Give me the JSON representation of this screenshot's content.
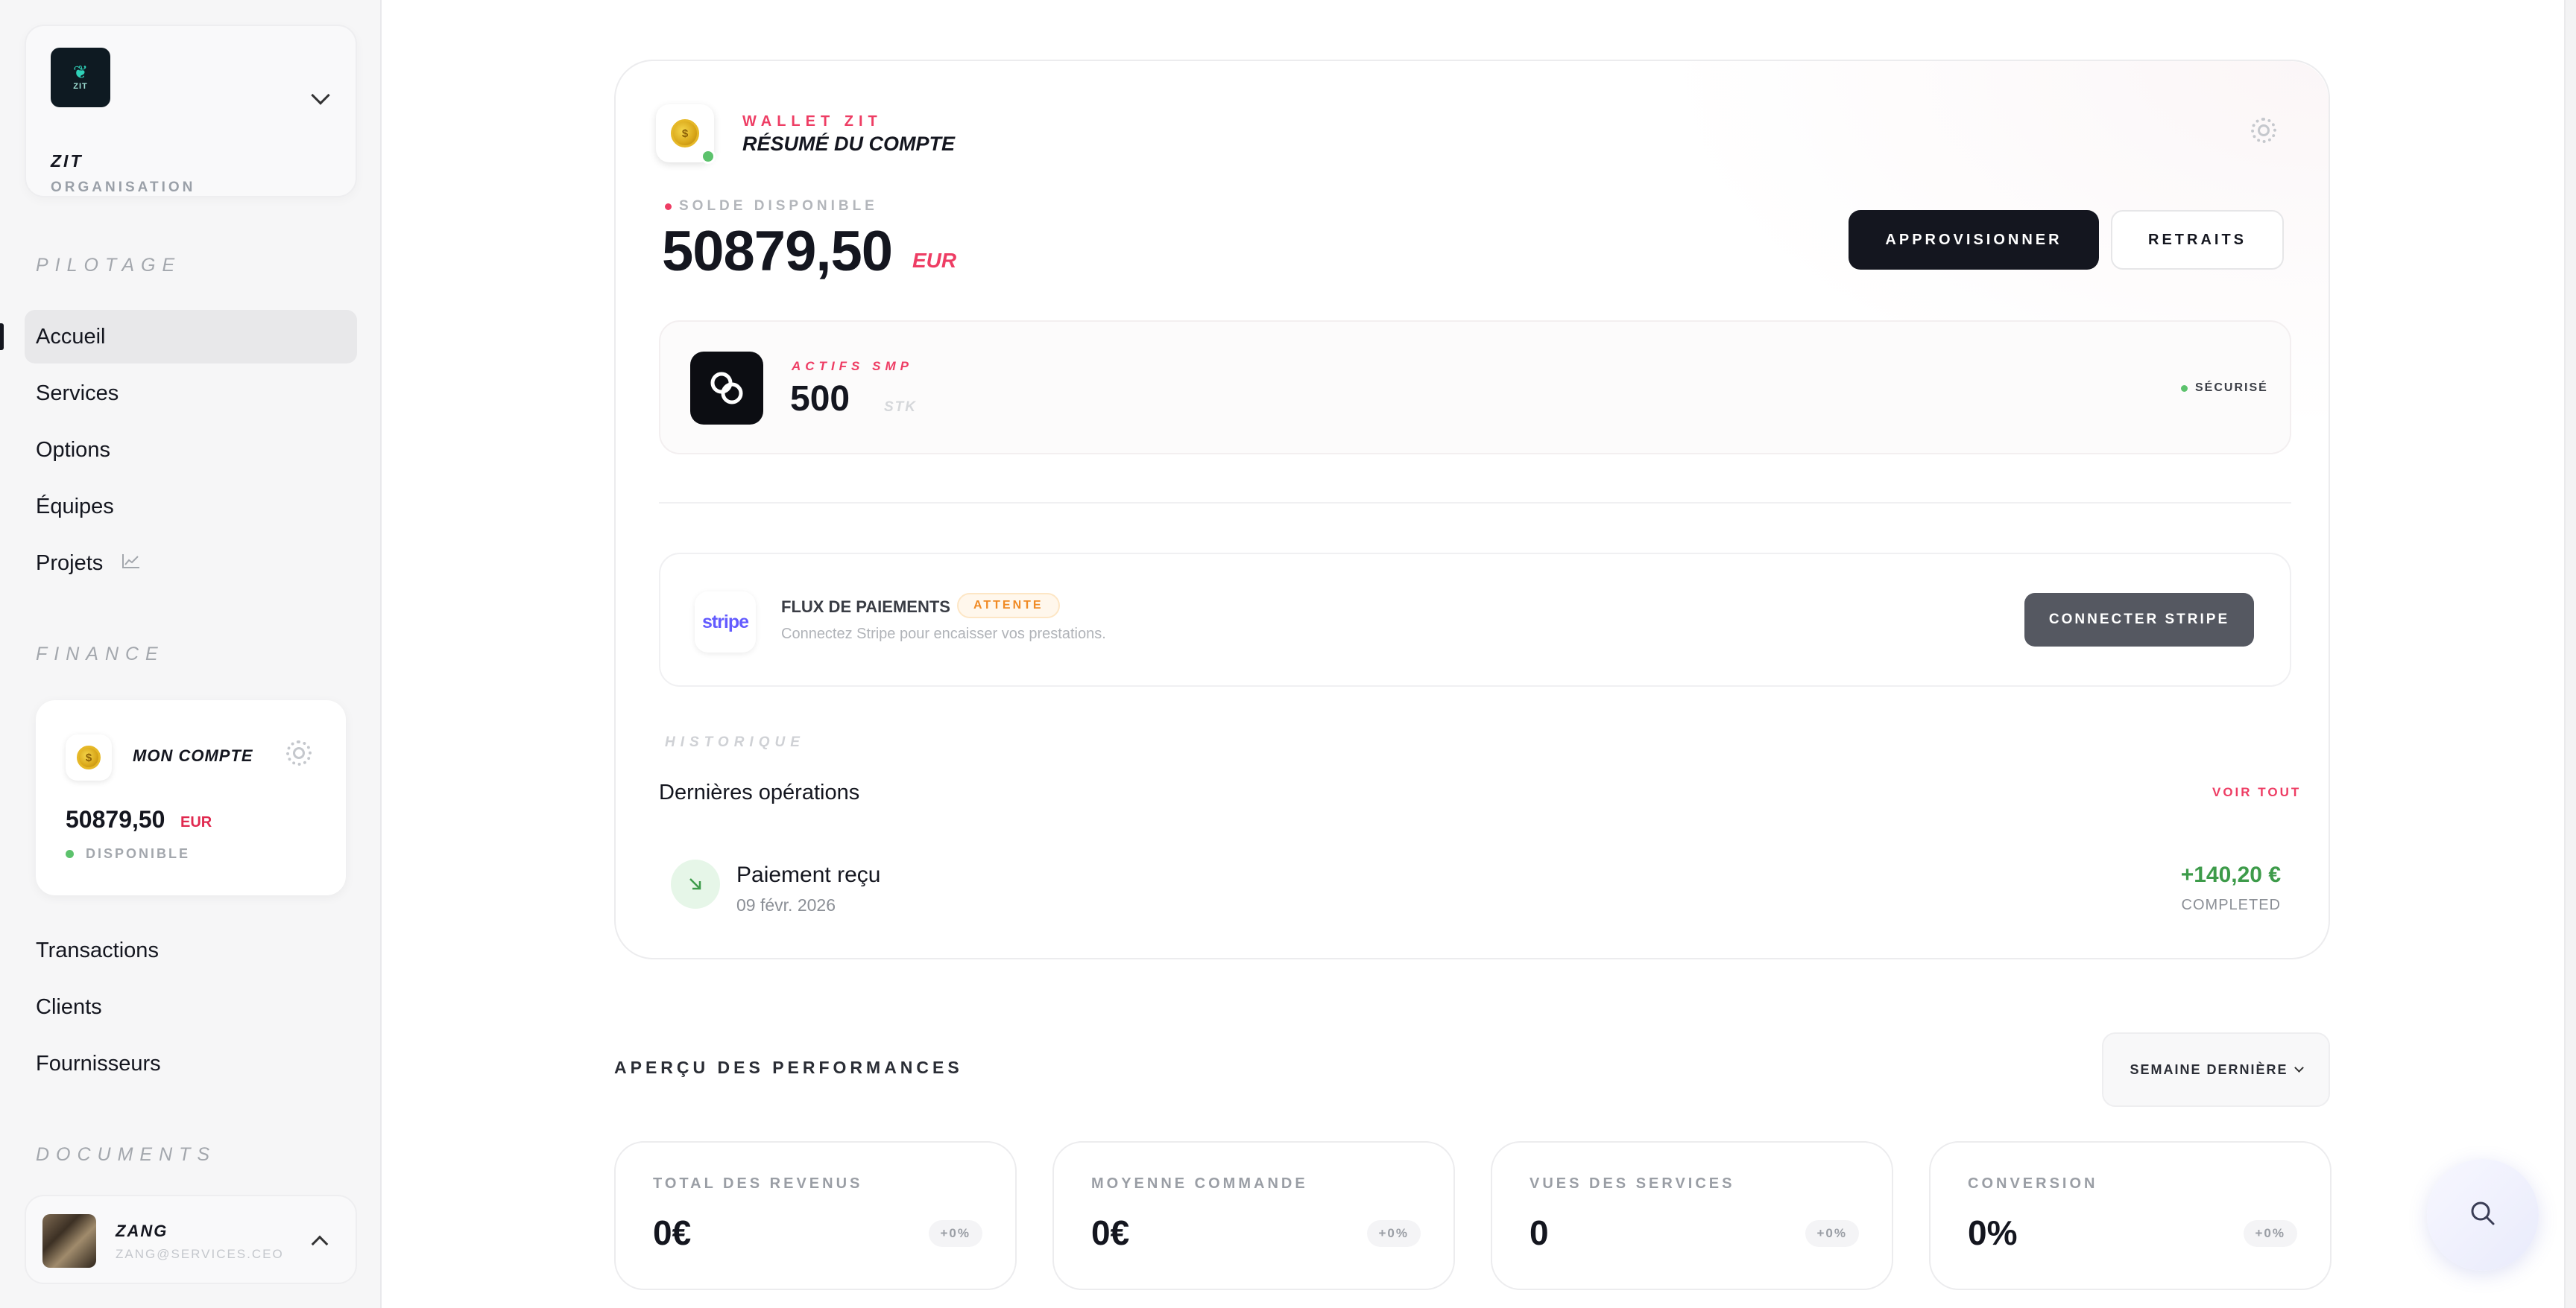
{
  "organization": {
    "logo_text": "ZIT",
    "name": "ZIT",
    "subtitle": "ORGANISATION"
  },
  "sidebar": {
    "sections": {
      "pilotage": "PILOTAGE",
      "finance": "FINANCE",
      "documents": "DOCUMENTS"
    },
    "pilotage_items": [
      {
        "label": "Accueil",
        "active": true
      },
      {
        "label": "Services"
      },
      {
        "label": "Options"
      },
      {
        "label": "Équipes"
      },
      {
        "label": "Projets",
        "icon": "chart-line-icon"
      }
    ],
    "finance_items": [
      {
        "label": "Transactions"
      },
      {
        "label": "Clients"
      },
      {
        "label": "Fournisseurs"
      }
    ],
    "account_card": {
      "title": "MON COMPTE",
      "amount": "50879,50",
      "currency": "EUR",
      "status": "DISPONIBLE"
    },
    "user": {
      "name": "ZANG",
      "email": "ZANG@SERVICES.CEO"
    }
  },
  "wallet": {
    "eyebrow": "WALLET ZIT",
    "title": "RÉSUMÉ DU COMPTE",
    "balance_label": "SOLDE DISPONIBLE",
    "balance": "50879,50",
    "currency": "EUR",
    "primary_button": "APPROVISIONNER",
    "secondary_button": "RETRAITS",
    "assets": {
      "label": "ACTIFS SMP",
      "value": "500",
      "unit": "STK",
      "status": "SÉCURISÉ"
    },
    "payments": {
      "logo_text": "stripe",
      "title": "FLUX DE PAIEMENTS",
      "badge": "ATTENTE",
      "description": "Connectez Stripe pour encaisser vos prestations.",
      "button": "CONNECTER STRIPE"
    },
    "history": {
      "label": "HISTORIQUE",
      "title": "Dernières opérations",
      "see_all": "VOIR TOUT",
      "operations": [
        {
          "name": "Paiement reçu",
          "date": "09 févr. 2026",
          "amount": "+140,20 €",
          "status": "COMPLETED"
        }
      ]
    }
  },
  "performance": {
    "title": "APERÇU DES PERFORMANCES",
    "period": "SEMAINE DERNIÈRE",
    "kpis": [
      {
        "label": "TOTAL DES REVENUS",
        "value": "0€",
        "change": "+0%"
      },
      {
        "label": "MOYENNE COMMANDE",
        "value": "0€",
        "change": "+0%"
      },
      {
        "label": "VUES DES SERVICES",
        "value": "0",
        "change": "+0%"
      },
      {
        "label": "CONVERSION",
        "value": "0%",
        "change": "+0%"
      }
    ]
  },
  "colors": {
    "accent": "#ee3d64",
    "dark": "#14161f",
    "success": "#3d9b4a",
    "warning": "#f08a24"
  }
}
